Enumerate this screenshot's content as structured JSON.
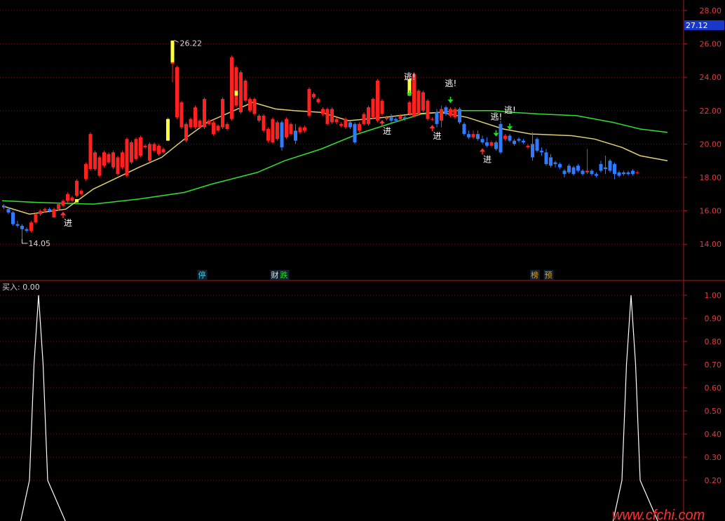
{
  "colors": {
    "bg": "#000000",
    "axis": "#b01818",
    "grid": "#6a1515",
    "tick": "#e03b3b",
    "up": "#ff2020",
    "down": "#2f7bff",
    "limit_up": "#ffff40",
    "ma_fast": "#e0d070",
    "ma_slow": "#30e030",
    "arrow_in": "#ff3030",
    "arrow_out": "#20e020",
    "text": "#ffffff",
    "price_box": "#1838c8",
    "watermark": "#ff3030",
    "signal_line": "#ffffff"
  },
  "watermark": "www.cfchi.com",
  "chart_data": [
    {
      "type": "candlestick",
      "ylim": [
        12.0,
        28.2
      ],
      "yticks": [
        "14.00",
        "16.00",
        "18.00",
        "20.00",
        "22.00",
        "24.00",
        "26.00",
        "28.00"
      ],
      "last_price": "27.12",
      "high_label": "26.22",
      "low_label": "14.05",
      "candles": [
        [
          16.3,
          16.4,
          16.1,
          16.2
        ],
        [
          16.1,
          16.2,
          15.8,
          15.9
        ],
        [
          15.9,
          16.0,
          15.1,
          15.2
        ],
        [
          15.2,
          15.4,
          15.0,
          15.1
        ],
        [
          15.1,
          15.2,
          14.05,
          14.9
        ],
        [
          14.9,
          15.0,
          14.7,
          14.8
        ],
        [
          14.8,
          15.4,
          14.7,
          15.3
        ],
        [
          15.3,
          15.9,
          15.2,
          15.8
        ],
        [
          15.8,
          16.1,
          15.7,
          16.0
        ],
        [
          16.0,
          16.2,
          15.9,
          16.1
        ],
        [
          16.1,
          16.2,
          15.9,
          16.0
        ],
        [
          15.6,
          16.2,
          15.6,
          16.1
        ],
        [
          16.1,
          16.5,
          16.0,
          16.4
        ],
        [
          16.3,
          16.7,
          16.2,
          16.6
        ],
        [
          16.6,
          17.1,
          16.5,
          17.0
        ],
        [
          16.6,
          16.9,
          16.5,
          16.8
        ],
        [
          16.9,
          17.9,
          16.8,
          17.8
        ],
        [
          17.0,
          17.3,
          16.9,
          17.2
        ],
        [
          17.9,
          18.9,
          17.8,
          18.8
        ],
        [
          18.5,
          20.7,
          18.4,
          20.6
        ],
        [
          18.5,
          19.6,
          18.4,
          19.5
        ],
        [
          18.1,
          19.3,
          18.0,
          19.2
        ],
        [
          18.7,
          19.6,
          18.6,
          19.5
        ],
        [
          18.9,
          19.5,
          18.8,
          19.4
        ],
        [
          18.6,
          19.6,
          18.5,
          19.5
        ],
        [
          18.2,
          19.3,
          18.1,
          19.2
        ],
        [
          18.6,
          19.6,
          18.5,
          19.5
        ],
        [
          18.1,
          20.4,
          18.0,
          20.3
        ],
        [
          18.9,
          20.2,
          18.8,
          20.1
        ],
        [
          19.1,
          20.4,
          19.0,
          20.3
        ],
        [
          19.3,
          20.5,
          19.2,
          20.4
        ],
        [
          19.8,
          20.0,
          19.7,
          19.9
        ],
        [
          19.0,
          20.1,
          18.9,
          20.0
        ],
        [
          19.6,
          20.1,
          19.5,
          20.0
        ],
        [
          19.4,
          20.0,
          19.3,
          19.9
        ],
        [
          19.5,
          19.8,
          19.4,
          19.7
        ],
        [
          21.5,
          21.6,
          21.4,
          21.5
        ],
        [
          24.8,
          26.22,
          23.7,
          26.1
        ],
        [
          21.6,
          24.7,
          21.5,
          24.6
        ],
        [
          21.0,
          22.6,
          20.9,
          22.5
        ],
        [
          20.2,
          21.3,
          20.1,
          21.2
        ],
        [
          21.0,
          21.6,
          20.9,
          21.5
        ],
        [
          21.0,
          22.3,
          20.9,
          22.2
        ],
        [
          21.0,
          21.5,
          20.9,
          21.4
        ],
        [
          21.0,
          22.8,
          20.9,
          22.7
        ],
        [
          21.2,
          21.5,
          21.1,
          21.4
        ],
        [
          20.6,
          21.4,
          20.5,
          21.3
        ],
        [
          20.8,
          21.2,
          20.7,
          21.1
        ],
        [
          21.0,
          22.8,
          20.9,
          22.7
        ],
        [
          20.9,
          21.3,
          20.8,
          21.2
        ],
        [
          21.5,
          25.3,
          21.4,
          25.2
        ],
        [
          22.3,
          24.7,
          22.2,
          24.6
        ],
        [
          21.9,
          24.4,
          21.8,
          24.3
        ],
        [
          22.6,
          23.9,
          22.5,
          23.8
        ],
        [
          22.0,
          22.8,
          21.9,
          22.7
        ],
        [
          21.8,
          22.8,
          21.7,
          22.7
        ],
        [
          21.4,
          21.8,
          21.3,
          21.7
        ],
        [
          20.8,
          21.8,
          20.7,
          21.7
        ],
        [
          20.2,
          21.0,
          20.1,
          20.9
        ],
        [
          20.1,
          21.6,
          20.0,
          21.5
        ],
        [
          20.3,
          21.4,
          20.2,
          21.3
        ],
        [
          21.3,
          21.4,
          19.6,
          19.8
        ],
        [
          20.4,
          21.6,
          20.3,
          21.5
        ],
        [
          20.6,
          21.3,
          20.5,
          21.2
        ],
        [
          20.8,
          21.2,
          20.0,
          20.2
        ],
        [
          20.7,
          21.1,
          20.6,
          21.0
        ],
        [
          20.8,
          21.1,
          20.7,
          21.0
        ],
        [
          21.7,
          23.4,
          21.6,
          23.3
        ],
        [
          22.8,
          23.1,
          22.7,
          23.0
        ],
        [
          22.5,
          22.8,
          22.4,
          22.7
        ],
        [
          21.8,
          22.2,
          21.7,
          22.1
        ],
        [
          21.2,
          22.2,
          21.1,
          22.1
        ],
        [
          21.3,
          22.2,
          21.2,
          22.1
        ],
        [
          21.3,
          21.6,
          21.2,
          21.5
        ],
        [
          21.1,
          21.3,
          21.0,
          21.2
        ],
        [
          21.0,
          21.6,
          20.9,
          21.5
        ],
        [
          21.3,
          21.4,
          20.9,
          21.0
        ],
        [
          21.2,
          21.3,
          20.0,
          20.1
        ],
        [
          20.8,
          21.3,
          20.7,
          21.2
        ],
        [
          21.2,
          21.9,
          21.1,
          21.8
        ],
        [
          21.2,
          22.3,
          21.1,
          22.2
        ],
        [
          21.6,
          22.8,
          21.5,
          22.7
        ],
        [
          21.4,
          23.9,
          21.3,
          23.8
        ],
        [
          21.8,
          22.7,
          21.7,
          22.6
        ],
        [
          21.5,
          21.7,
          21.4,
          21.6
        ],
        [
          21.6,
          21.8,
          21.2,
          21.4
        ],
        [
          21.5,
          21.6,
          21.3,
          21.4
        ],
        [
          21.5,
          21.8,
          21.4,
          21.7
        ],
        [
          21.6,
          21.7,
          21.4,
          21.5
        ],
        [
          21.8,
          22.6,
          21.7,
          22.5
        ],
        [
          21.7,
          24.3,
          21.6,
          24.2
        ],
        [
          21.8,
          23.3,
          21.7,
          23.2
        ],
        [
          22.0,
          23.2,
          21.9,
          23.1
        ],
        [
          21.5,
          22.7,
          21.4,
          22.6
        ],
        [
          21.5,
          21.6,
          21.4,
          21.5
        ],
        [
          21.9,
          22.1,
          21.0,
          21.2
        ],
        [
          21.4,
          22.3,
          21.0,
          22.1
        ],
        [
          22.2,
          22.3,
          21.7,
          21.8
        ],
        [
          21.7,
          22.2,
          21.6,
          22.1
        ],
        [
          21.6,
          22.2,
          21.5,
          22.1
        ],
        [
          22.1,
          22.2,
          21.2,
          21.3
        ],
        [
          21.2,
          21.3,
          20.5,
          20.6
        ],
        [
          20.6,
          20.8,
          20.3,
          20.4
        ],
        [
          20.4,
          20.8,
          20.3,
          20.6
        ],
        [
          20.6,
          20.8,
          20.2,
          20.3
        ],
        [
          20.3,
          20.5,
          20.0,
          20.1
        ],
        [
          20.1,
          20.4,
          19.8,
          19.9
        ],
        [
          19.9,
          20.2,
          19.8,
          20.1
        ],
        [
          20.1,
          20.2,
          19.6,
          19.7
        ],
        [
          21.2,
          21.4,
          19.4,
          19.5
        ],
        [
          20.3,
          20.6,
          20.2,
          20.5
        ],
        [
          20.5,
          20.6,
          20.1,
          20.2
        ],
        [
          20.2,
          20.3,
          19.9,
          20.0
        ],
        [
          20.3,
          20.4,
          20.1,
          20.2
        ],
        [
          20.2,
          20.3,
          20.0,
          20.1
        ],
        [
          19.8,
          20.0,
          19.7,
          19.9
        ],
        [
          20.0,
          20.7,
          19.0,
          19.2
        ],
        [
          20.3,
          20.4,
          19.5,
          19.6
        ],
        [
          19.6,
          19.8,
          19.3,
          19.5
        ],
        [
          19.5,
          19.7,
          18.7,
          18.8
        ],
        [
          19.2,
          19.4,
          18.6,
          18.7
        ],
        [
          18.9,
          19.0,
          18.6,
          18.8
        ],
        [
          18.8,
          18.9,
          18.5,
          18.6
        ],
        [
          18.4,
          18.5,
          18.0,
          18.2
        ],
        [
          18.7,
          18.8,
          18.2,
          18.3
        ],
        [
          18.6,
          18.7,
          18.1,
          18.2
        ],
        [
          18.7,
          18.8,
          18.3,
          18.4
        ],
        [
          18.4,
          18.5,
          18.1,
          18.2
        ],
        [
          18.3,
          19.7,
          18.2,
          18.4
        ],
        [
          18.4,
          18.5,
          18.1,
          18.2
        ],
        [
          18.2,
          18.3,
          18.0,
          18.1
        ],
        [
          18.8,
          19.0,
          18.3,
          18.4
        ],
        [
          18.6,
          19.3,
          18.2,
          18.5
        ],
        [
          19.0,
          19.1,
          18.3,
          18.4
        ],
        [
          18.8,
          18.9,
          17.9,
          18.2
        ],
        [
          18.3,
          18.4,
          18.0,
          18.1
        ],
        [
          18.3,
          18.4,
          18.1,
          18.2
        ],
        [
          18.3,
          18.4,
          18.1,
          18.2
        ],
        [
          18.4,
          18.5,
          18.1,
          18.2
        ],
        [
          18.3,
          18.4,
          18.2,
          18.3
        ]
      ],
      "limit_up_bars": [
        {
          "index": 16,
          "low": 16.5,
          "high": 16.7
        },
        {
          "index": 36,
          "low": 20.2,
          "high": 21.5
        },
        {
          "index": 37,
          "low": 24.9,
          "high": 26.2
        },
        {
          "index": 51,
          "low": 22.9,
          "high": 23.2
        },
        {
          "index": 89,
          "low": 22.9,
          "high": 23.9
        }
      ],
      "ma_fast": [
        [
          0,
          16.3
        ],
        [
          6,
          15.8
        ],
        [
          14,
          16.1
        ],
        [
          20,
          17.3
        ],
        [
          30,
          18.6
        ],
        [
          35,
          19.2
        ],
        [
          40,
          20.3
        ],
        [
          45,
          21.3
        ],
        [
          50,
          21.9
        ],
        [
          55,
          22.5
        ],
        [
          60,
          22.1
        ],
        [
          64,
          22.0
        ],
        [
          70,
          21.9
        ],
        [
          76,
          21.4
        ],
        [
          84,
          21.6
        ],
        [
          90,
          21.8
        ],
        [
          96,
          21.9
        ],
        [
          102,
          21.6
        ],
        [
          110,
          20.9
        ],
        [
          116,
          20.6
        ],
        [
          125,
          20.5
        ],
        [
          130,
          20.3
        ],
        [
          136,
          19.8
        ],
        [
          140,
          19.3
        ],
        [
          146,
          19.0
        ]
      ],
      "ma_slow": [
        [
          0,
          16.6
        ],
        [
          8,
          16.5
        ],
        [
          20,
          16.4
        ],
        [
          30,
          16.7
        ],
        [
          40,
          17.1
        ],
        [
          46,
          17.6
        ],
        [
          56,
          18.3
        ],
        [
          62,
          19.0
        ],
        [
          70,
          19.7
        ],
        [
          78,
          20.6
        ],
        [
          86,
          21.3
        ],
        [
          92,
          21.8
        ],
        [
          100,
          22.0
        ],
        [
          108,
          22.0
        ],
        [
          112,
          21.9
        ],
        [
          118,
          21.8
        ],
        [
          126,
          21.7
        ],
        [
          134,
          21.3
        ],
        [
          140,
          20.9
        ],
        [
          146,
          20.7
        ]
      ],
      "signals_in": [
        {
          "index": 13,
          "label": "进"
        },
        {
          "index": 83,
          "label": "进"
        },
        {
          "index": 94,
          "label": "进"
        },
        {
          "index": 105,
          "label": "进"
        }
      ],
      "signals_out": [
        {
          "index": 89,
          "label": "逃!"
        },
        {
          "index": 98,
          "label": "逃!"
        },
        {
          "index": 108,
          "label": "逃!"
        },
        {
          "index": 111,
          "label": "逃!"
        }
      ],
      "event_tags": [
        {
          "index": 43,
          "label": "停",
          "color": "#30c8e0"
        },
        {
          "index": 59,
          "label": "财",
          "color": "#e0e0e0"
        },
        {
          "index": 61,
          "label": "跌",
          "color": "#20e020"
        },
        {
          "index": 116,
          "label": "榜",
          "color": "#e0a020"
        },
        {
          "index": 119,
          "label": "预",
          "color": "#e0a020"
        }
      ]
    },
    {
      "type": "line",
      "title": "买入: 0.00",
      "ylim": [
        0.1,
        1.05
      ],
      "yticks": [
        "1.00",
        "0.90",
        "0.80",
        "0.70",
        "0.60",
        "0.50",
        "0.40",
        "0.30",
        "0.20"
      ],
      "series": [
        {
          "values_note": "",
          "x": [
            0,
            4,
            6,
            7,
            8,
            9,
            10,
            14,
            130,
            134,
            136,
            137,
            138,
            139,
            140,
            144
          ],
          "y": [
            0,
            0,
            0.2,
            0.7,
            1.0,
            0.7,
            0.2,
            0,
            0,
            0,
            0.2,
            0.7,
            1.0,
            0.7,
            0.2,
            0
          ]
        }
      ]
    }
  ]
}
